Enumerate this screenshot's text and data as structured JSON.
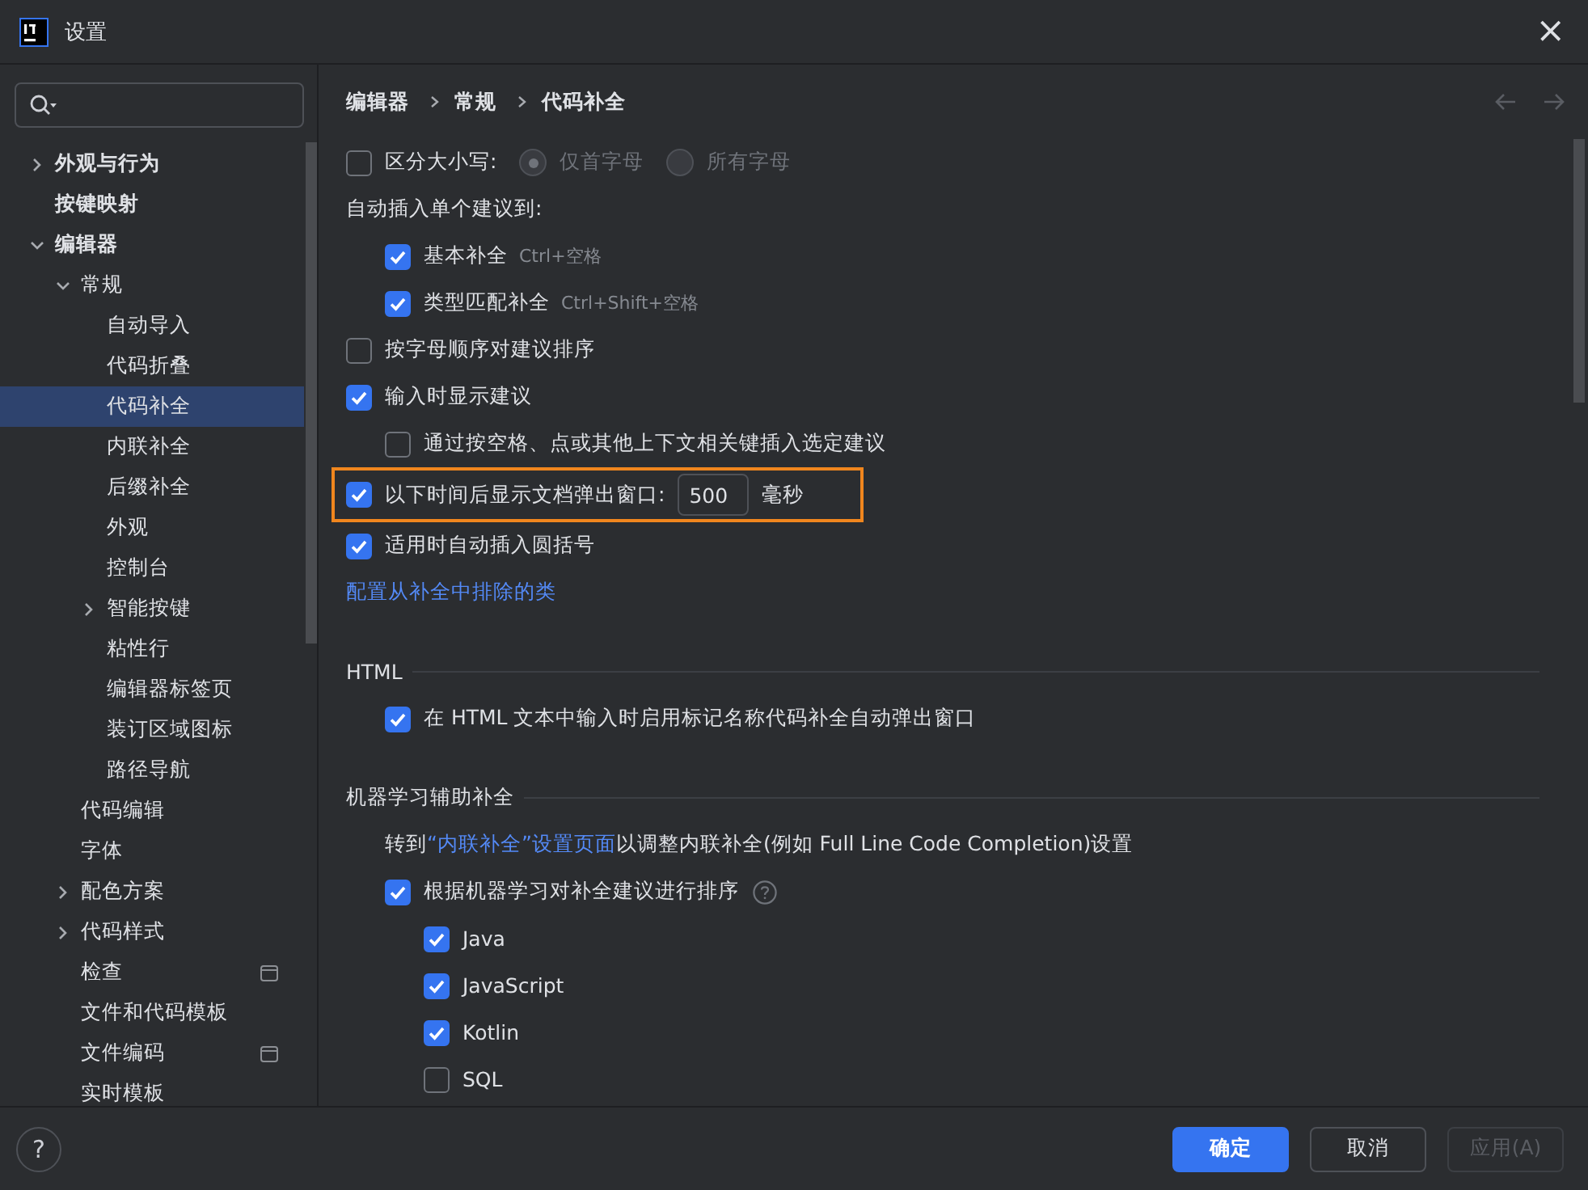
{
  "window": {
    "title": "设置",
    "close_glyph": "×"
  },
  "sidebar": {
    "items": [
      {
        "label": "外观与行为",
        "expanded": false
      },
      {
        "label": "按键映射"
      },
      {
        "label": "编辑器",
        "expanded": true,
        "children": [
          {
            "label": "常规",
            "expanded": true,
            "children": [
              {
                "label": "自动导入",
                "selected": false
              },
              {
                "label": "代码折叠",
                "selected": false
              },
              {
                "label": "代码补全",
                "selected": true
              },
              {
                "label": "内联补全",
                "selected": false
              },
              {
                "label": "后缀补全",
                "selected": false
              },
              {
                "label": "外观",
                "selected": false
              },
              {
                "label": "控制台",
                "selected": false
              },
              {
                "label": "智能按键",
                "selected": false,
                "expanded": false
              },
              {
                "label": "粘性行",
                "selected": false
              },
              {
                "label": "编辑器标签页",
                "selected": false
              },
              {
                "label": "装订区域图标",
                "selected": false
              },
              {
                "label": "路径导航",
                "selected": false
              }
            ]
          },
          {
            "label": "代码编辑"
          },
          {
            "label": "字体"
          },
          {
            "label": "配色方案",
            "expanded": false
          },
          {
            "label": "代码样式",
            "expanded": false
          },
          {
            "label": "检查",
            "project_icon": true
          },
          {
            "label": "文件和代码模板"
          },
          {
            "label": "文件编码",
            "project_icon": true
          },
          {
            "label": "实时模板"
          }
        ]
      }
    ]
  },
  "breadcrumb": [
    "编辑器",
    "常规",
    "代码补全"
  ],
  "options": [
    {
      "kind": "radios",
      "label": "区分大小写:",
      "checked": false,
      "radios": [
        {
          "label": "仅首字母",
          "selected": true,
          "disabled": true
        },
        {
          "label": "所有字母",
          "selected": false,
          "disabled": true
        }
      ]
    },
    {
      "kind": "label",
      "label": "自动插入单个建议到:",
      "children": [
        {
          "kind": "checkbox",
          "label": "基本补全",
          "hint": "Ctrl+空格",
          "checked": true
        },
        {
          "kind": "checkbox",
          "label": "类型匹配补全",
          "hint": "Ctrl+Shift+空格",
          "checked": true
        }
      ]
    },
    {
      "kind": "checkbox",
      "label": "按字母顺序对建议排序",
      "checked": false
    },
    {
      "kind": "checkbox",
      "label": "输入时显示建议",
      "checked": true,
      "children": [
        {
          "kind": "checkbox",
          "label": "通过按空格、点或其他上下文相关键插入选定建议",
          "checked": false
        }
      ]
    },
    {
      "kind": "delay",
      "label": "以下时间后显示文档弹出窗口:",
      "checked": true,
      "value": "500",
      "unit": "毫秒",
      "highlighted": true
    },
    {
      "kind": "checkbox",
      "label": "适用时自动插入圆括号",
      "checked": true
    },
    {
      "kind": "link",
      "label": "配置从补全中排除的类"
    }
  ],
  "sections": [
    {
      "title": "HTML",
      "options": [
        {
          "kind": "checkbox",
          "label": "在 HTML 文本中输入时启用标记名称代码补全自动弹出窗口",
          "checked": true
        }
      ]
    },
    {
      "title": "机器学习辅助补全",
      "options": [
        {
          "kind": "note",
          "before": "转到",
          "link": "“内联补全”设置页面",
          "after": "以调整内联补全(例如 Full Line Code Completion)设置"
        },
        {
          "kind": "checkbox",
          "label": "根据机器学习对补全建议进行排序",
          "checked": true,
          "help": true,
          "children": [
            {
              "kind": "checkbox",
              "label": "Java",
              "checked": true
            },
            {
              "kind": "checkbox",
              "label": "JavaScript",
              "checked": true
            },
            {
              "kind": "checkbox",
              "label": "Kotlin",
              "checked": true
            },
            {
              "kind": "checkbox",
              "label": "SQL",
              "checked": false
            }
          ]
        }
      ]
    }
  ],
  "footer": {
    "help_glyph": "?",
    "buttons": [
      {
        "label": "确定",
        "kind": "primary",
        "disabled": false
      },
      {
        "label": "取消",
        "kind": "normal",
        "disabled": false
      },
      {
        "label": "应用(A)",
        "kind": "normal",
        "disabled": true
      }
    ]
  }
}
